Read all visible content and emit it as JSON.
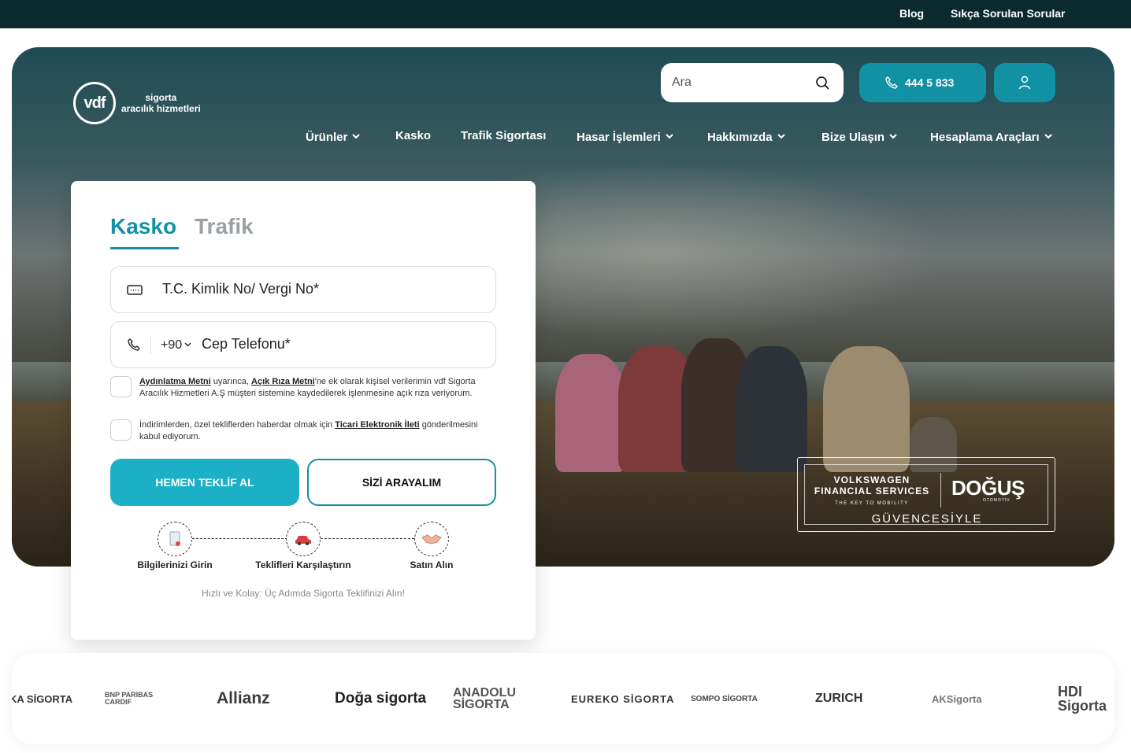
{
  "topbar": {
    "blog": "Blog",
    "faq": "Sıkça Sorulan Sorular"
  },
  "brand": {
    "logo_mark": "vdf",
    "line1": "sigorta",
    "line2": "aracılık hizmetleri"
  },
  "header": {
    "search_placeholder": "Ara",
    "phone": "444 5 833",
    "nav": [
      "Ürünler",
      "Kasko",
      "Trafik Sigortası",
      "Hasar İşlemleri",
      "Hakkımızda",
      "Bize Ulaşın",
      "Hesaplama Araçları"
    ]
  },
  "form": {
    "tabs": {
      "active": "Kasko",
      "inactive": "Trafik"
    },
    "id_placeholder": "T.C. Kimlik No/ Vergi No*",
    "country_code": "+90",
    "phone_placeholder": "Cep Telefonu*",
    "consent1": {
      "link1": "Aydınlatma Metni",
      "mid": " uyarınca, ",
      "link2": "Açık Rıza Metni",
      "rest": "'ne ek olarak kişisel verilerimin vdf Sigorta Aracılık Hizmetleri A.Ş müşteri sistemine kaydedilerek işlenmesine açık rıza veriyorum."
    },
    "consent2": {
      "pre": "İndirimlerden, özel tekliflerden haberdar olmak için ",
      "link": "Ticari Elektronik İleti",
      "rest": " gönderilmesini kabul ediyorum."
    },
    "primary_button": "HEMEN TEKLİF AL",
    "secondary_button": "SİZİ ARAYALIM",
    "steps": [
      "Bilgilerinizi Girin",
      "Teklifleri Karşılaştırın",
      "Satın Alın"
    ],
    "tagline": "Hızlı ve Kolay: Üç Adımda Sigorta Teklifinizi Alın!"
  },
  "badge": {
    "vw_line1": "VOLKSWAGEN",
    "vw_line2": "FINANCIAL SERVICES",
    "vw_tagline": "THE KEY TO MOBILITY",
    "dogus": "DOĞUŞ",
    "dogus_sub": "OTOMOTİV",
    "bottom": "GÜVENCESİYLE"
  },
  "partners": [
    "KA SİGORTA",
    "BNP PARIBAS CARDIF",
    "Allianz",
    "Doğa sigorta",
    "ANADOLU SİGORTA",
    "EUREKO SİGORTA",
    "SOMPO SİGORTA",
    "ZURICH",
    "AKSigorta",
    "HDI Sigorta"
  ],
  "colors": {
    "accent": "#1291a5",
    "accent_light": "#1cb0c6",
    "topbar": "#0b2a30"
  }
}
